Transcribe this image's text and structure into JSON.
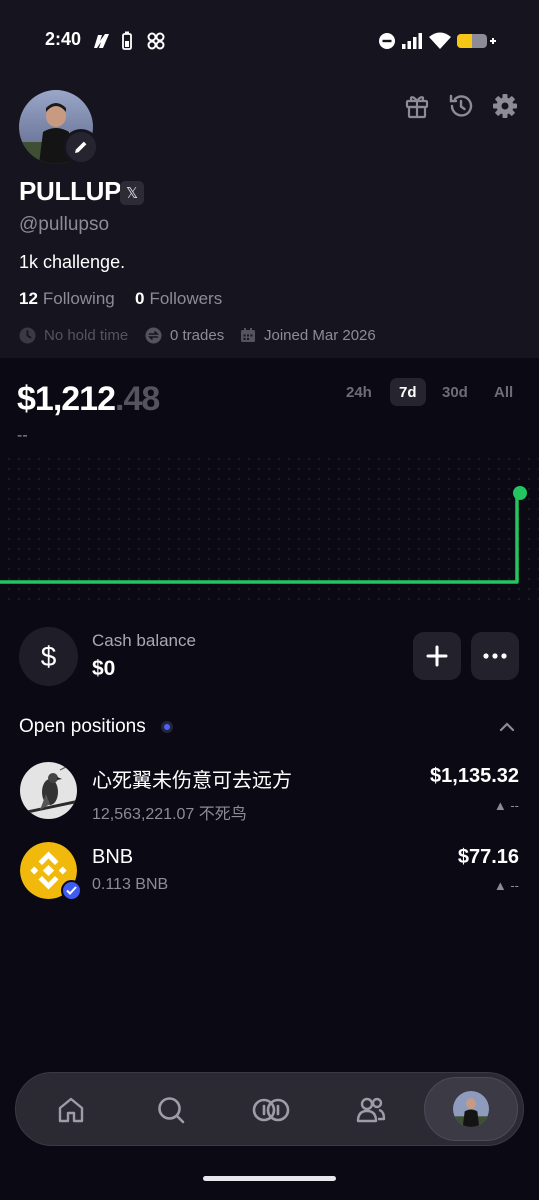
{
  "status_bar": {
    "time": "2:40"
  },
  "profile": {
    "name": "PULLUP",
    "x_badge": "𝕏",
    "handle": "@pullupso",
    "bio": "1k challenge.",
    "following_count": "12",
    "following_label": "Following",
    "followers_count": "0",
    "followers_label": "Followers",
    "hold_time": "No hold time",
    "trades": "0 trades",
    "joined": "Joined Mar 2026"
  },
  "portfolio": {
    "balance_int": "$1,212",
    "balance_dec": ".48",
    "change": "--",
    "ranges": [
      "24h",
      "7d",
      "30d",
      "All"
    ],
    "active_range": "7d",
    "line_color": "#22c55e"
  },
  "cash": {
    "icon": "$",
    "label": "Cash balance",
    "value": "$0"
  },
  "positions": {
    "title": "Open positions",
    "items": [
      {
        "name": "心死翼未伤意可去远方",
        "amount": "12,563,221.07 不死鸟",
        "value": "$1,135.32",
        "change": "▲ --"
      },
      {
        "name": "BNB",
        "amount": "0.113 BNB",
        "value": "$77.16",
        "change": "▲ --"
      }
    ]
  },
  "nav": {
    "items": [
      "home-icon",
      "search-icon",
      "trade-icon",
      "people-icon",
      "profile-avatar"
    ],
    "active": "profile-avatar"
  }
}
